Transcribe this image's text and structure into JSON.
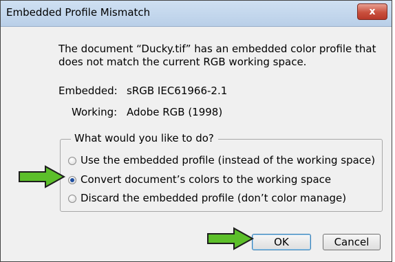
{
  "window": {
    "title": "Embedded Profile Mismatch",
    "close_label": "x"
  },
  "message": {
    "line1": "The document “Ducky.tif” has an embedded color profile that",
    "line2": "does not match the current RGB working space."
  },
  "profiles": {
    "embedded_label": "Embedded:",
    "embedded_value": "sRGB IEC61966-2.1",
    "working_label": "Working:",
    "working_value": "Adobe RGB (1998)"
  },
  "options": {
    "group_label": "What would you like to do?",
    "items": [
      {
        "label": "Use the embedded profile (instead of the working space)",
        "checked": false
      },
      {
        "label": "Convert document’s colors to the working space",
        "checked": true
      },
      {
        "label": "Discard the embedded profile (don’t color manage)",
        "checked": false
      }
    ]
  },
  "buttons": {
    "ok": "OK",
    "cancel": "Cancel"
  },
  "colors": {
    "arrow_fill": "#5cbf2a",
    "arrow_stroke": "#1d1d1d"
  }
}
